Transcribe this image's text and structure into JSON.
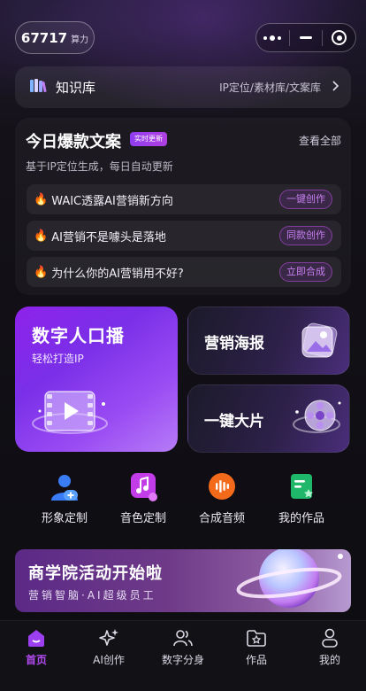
{
  "header": {
    "points_value": "67717",
    "points_unit": "算力",
    "capsule_icons": [
      "more-dots-icon",
      "minimize-icon",
      "close-target-icon"
    ]
  },
  "knowledge": {
    "title": "知识库",
    "subtitle": "IP定位/素材库/文案库",
    "icon": "books-icon"
  },
  "hot_copy": {
    "title": "今日爆款文案",
    "badge": "实时更新",
    "view_all": "查看全部",
    "description": "基于IP定位生成，每日自动更新",
    "items": [
      {
        "icon": "fire-icon",
        "text": "WAIC透露AI营销新方向",
        "action": "一键创作"
      },
      {
        "icon": "fire-icon",
        "text": "AI营销不是噱头是落地",
        "action": "同款创作"
      },
      {
        "icon": "fire-icon",
        "text": "为什么你的AI营销用不好?",
        "action": "立即合成"
      }
    ]
  },
  "features": {
    "digital_human": {
      "title": "数字人口播",
      "subtitle": "轻松打造IP",
      "icon": "film-play-icon"
    },
    "poster": {
      "title": "营销海报",
      "icon": "image-card-icon"
    },
    "video": {
      "title": "一键大片",
      "icon": "film-reel-icon"
    }
  },
  "quick_actions": [
    {
      "label": "形象定制",
      "icon": "avatar-add-icon"
    },
    {
      "label": "音色定制",
      "icon": "music-note-icon"
    },
    {
      "label": "合成音频",
      "icon": "audio-wave-icon"
    },
    {
      "label": "我的作品",
      "icon": "works-list-icon"
    }
  ],
  "banner": {
    "title": "商学院活动开始啦",
    "subtitle": "营销智脑·AI超级员工",
    "icon": "planet-icon"
  },
  "tabbar": {
    "active": "首页",
    "accent": "#b44bf2",
    "tabs": [
      {
        "label": "首页",
        "icon": "home-icon"
      },
      {
        "label": "AI创作",
        "icon": "sparkle-icon"
      },
      {
        "label": "数字分身",
        "icon": "users-icon"
      },
      {
        "label": "作品",
        "icon": "folder-star-icon"
      },
      {
        "label": "我的",
        "icon": "person-icon"
      }
    ]
  }
}
